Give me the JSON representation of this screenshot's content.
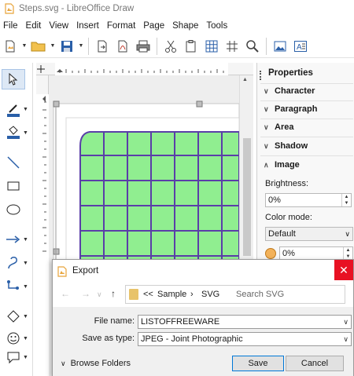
{
  "window": {
    "title": "Steps.svg - LibreOffice Draw"
  },
  "menu": [
    "File",
    "Edit",
    "View",
    "Insert",
    "Format",
    "Page",
    "Shape",
    "Tools"
  ],
  "toolbar": {
    "icons": [
      "new-document-icon",
      "open-folder-icon",
      "save-icon",
      "export-icon",
      "export-pdf-icon",
      "print-icon",
      "cut-icon",
      "paste-icon",
      "grid-icon",
      "snap-grid-icon",
      "zoom-icon",
      "image-icon",
      "text-box-icon"
    ]
  },
  "tools": [
    "select-icon",
    "line-color-icon",
    "fill-color-icon",
    "line-tool-icon",
    "rectangle-tool-icon",
    "ellipse-tool-icon",
    "arrow-line-icon",
    "curve-tool-icon",
    "connector-icon",
    "diamond-shape-icon",
    "smiley-shape-icon",
    "callout-shape-icon"
  ],
  "sidebar": {
    "title": "Properties",
    "sections": {
      "character": "Character",
      "paragraph": "Paragraph",
      "area": "Area",
      "shadow": "Shadow",
      "image": "Image"
    },
    "brightness_label": "Brightness:",
    "brightness_value": "0%",
    "color_mode_label": "Color mode:",
    "color_mode_value": "Default",
    "transparency_value": "0%"
  },
  "dialog": {
    "title": "Export",
    "path": {
      "separator": "<<",
      "folder1": "Sample",
      "folder2": "SVG"
    },
    "search_placeholder": "Search SVG",
    "file_name_label": "File name:",
    "file_name_value": "LISTOFFREEWARE",
    "type_label": "Save as type:",
    "type_value": "JPEG - Joint Photographic",
    "browse_label": "Browse Folders",
    "save_label": "Save",
    "cancel_label": "Cancel"
  },
  "colors": {
    "grid_fill": "#90ee90",
    "grid_line": "#5a3ea8",
    "accent": "#0078d7",
    "close": "#e81123"
  }
}
